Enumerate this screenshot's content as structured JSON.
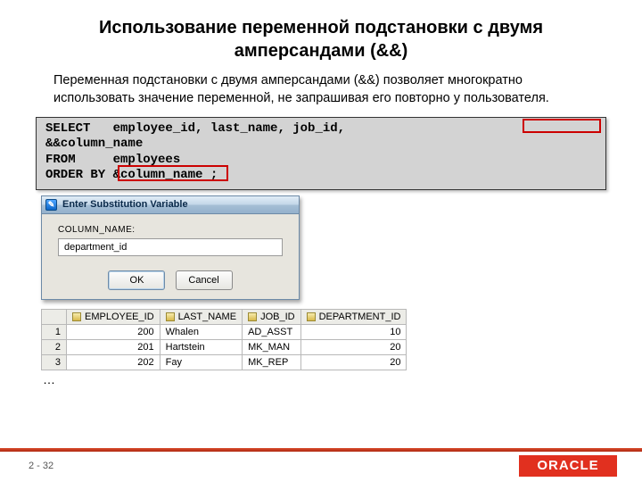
{
  "title": "Использование переменной подстановки с двумя амперсандами (&&)",
  "body": "Переменная подстановки с двумя амперсандами (&&) позволяет многократно использовать значение переменной, не запрашивая его повторно у пользователя.",
  "code": "SELECT   employee_id, last_name, job_id,\n&&column_name\nFROM     employees\nORDER BY &column_name ;",
  "dialog": {
    "title": "Enter Substitution Variable",
    "label": "COLUMN_NAME:",
    "value": "department_id",
    "ok": "OK",
    "cancel": "Cancel"
  },
  "grid": {
    "headers": [
      "EMPLOYEE_ID",
      "LAST_NAME",
      "JOB_ID",
      "DEPARTMENT_ID"
    ],
    "rows": [
      {
        "n": "1",
        "emp": "200",
        "last": "Whalen",
        "job": "AD_ASST",
        "dept": "10"
      },
      {
        "n": "2",
        "emp": "201",
        "last": "Hartstein",
        "job": "MK_MAN",
        "dept": "20"
      },
      {
        "n": "3",
        "emp": "202",
        "last": "Fay",
        "job": "MK_REP",
        "dept": "20"
      }
    ]
  },
  "ellipsis": "…",
  "page": "2 - 32",
  "logo": "ORACLE"
}
